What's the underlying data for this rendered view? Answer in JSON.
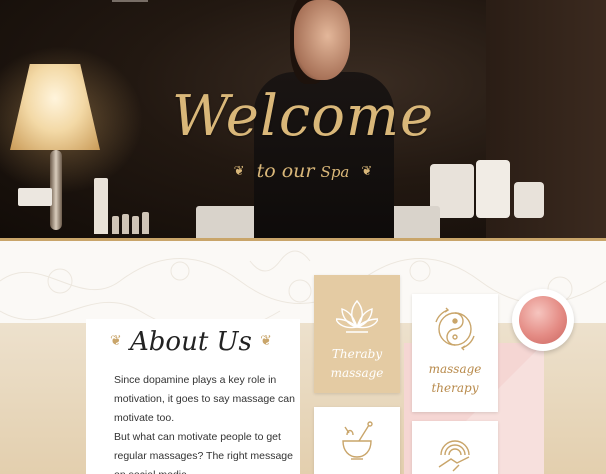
{
  "hero": {
    "welcome": "Welcome",
    "tagline_prefix": "to our",
    "tagline_spa": "Spa",
    "ornament": "❦"
  },
  "about": {
    "title": "About Us",
    "ornament": "❦",
    "paragraphs": [
      "Since dopamine plays a key role in motivation, it goes to say massage can motivate too.",
      "But what can motivate people to get regular massages? The right message on social media"
    ]
  },
  "services": [
    {
      "label": "Theraby massage",
      "icon": "lotus-icon",
      "style": "tan"
    },
    {
      "label": "massage therapy",
      "icon": "yin-yang-icon",
      "style": "white"
    },
    {
      "label": "",
      "icon": "mortar-pestle-icon",
      "style": "white"
    },
    {
      "label": "",
      "icon": "hand-wave-icon",
      "style": "white"
    }
  ],
  "colors": {
    "gold": "#c9a56a",
    "hero_text": "#d9b779",
    "tan_card": "#e4cba3",
    "pink": "#f5d6d3"
  }
}
